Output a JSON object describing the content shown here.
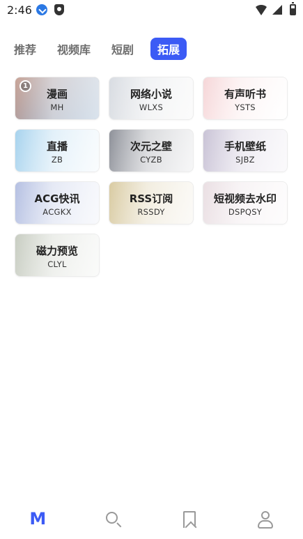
{
  "status_bar": {
    "time": "2:46",
    "icons": [
      "download-icon",
      "shield-icon",
      "wifi-icon",
      "signal-icon",
      "battery-icon"
    ]
  },
  "tabs": [
    {
      "label": "推荐",
      "active": false
    },
    {
      "label": "视频库",
      "active": false
    },
    {
      "label": "短剧",
      "active": false
    },
    {
      "label": "拓展",
      "active": true
    }
  ],
  "accent_color": "#3c5bf5",
  "cards": [
    {
      "title": "漫画",
      "code": "MH",
      "badge": "1",
      "tint": [
        "#c9a497",
        "#6a8fb6"
      ]
    },
    {
      "title": "网络小说",
      "code": "WLXS",
      "tint": [
        "#d8dce2",
        "#f1f1f1"
      ]
    },
    {
      "title": "有声听书",
      "code": "YSTS",
      "tint": [
        "#f6d6d8",
        "#ffffff"
      ]
    },
    {
      "title": "直播",
      "code": "ZB",
      "tint": [
        "#a7d3ee",
        "#e9f3fa"
      ]
    },
    {
      "title": "次元之壁",
      "code": "CYZB",
      "tint": [
        "#8e9199",
        "#dcdde0"
      ]
    },
    {
      "title": "手机壁纸",
      "code": "SJBZ",
      "tint": [
        "#c9c3d6",
        "#eeeaf2"
      ]
    },
    {
      "title": "ACG快讯",
      "code": "ACGKX",
      "tint": [
        "#b5c0e2",
        "#e5e9f5"
      ]
    },
    {
      "title": "RSS订阅",
      "code": "RSSDY",
      "tint": [
        "#d9cba2",
        "#f1ece1"
      ]
    },
    {
      "title": "短视频去水印",
      "code": "DSPQSY",
      "tint": [
        "#eadfe3",
        "#f8f4f6"
      ]
    },
    {
      "title": "磁力预览",
      "code": "CLYL",
      "tint": [
        "#c8cdc2",
        "#eceeea"
      ]
    }
  ],
  "bottom_nav": [
    {
      "name": "home",
      "label": "M",
      "active": true
    },
    {
      "name": "search",
      "active": false
    },
    {
      "name": "bookmark",
      "active": false
    },
    {
      "name": "profile",
      "active": false
    }
  ]
}
